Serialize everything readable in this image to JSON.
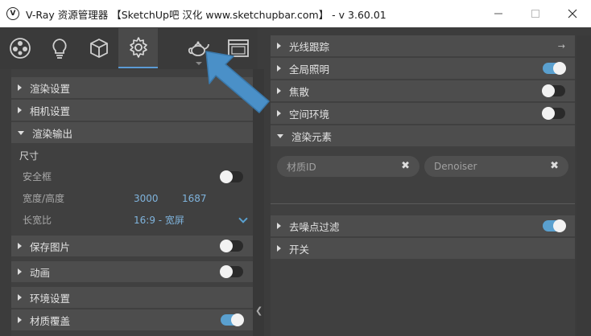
{
  "window": {
    "title": "V-Ray 资源管理器 【SketchUp吧 汉化 www.sketchupbar.com】 - v 3.60.01",
    "app_icon": "vray-logo-icon",
    "controls": [
      "minimize",
      "maximize",
      "close"
    ]
  },
  "toolbar": {
    "tools": [
      {
        "name": "materials",
        "icon": "material-palette-icon"
      },
      {
        "name": "lights",
        "icon": "bulb-icon"
      },
      {
        "name": "geometry",
        "icon": "cube-icon"
      },
      {
        "name": "settings",
        "icon": "gear-icon",
        "active": true
      },
      {
        "name": "render",
        "icon": "teapot-icon"
      },
      {
        "name": "frame-buffer",
        "icon": "frame-buffer-icon"
      }
    ]
  },
  "left": {
    "sections": {
      "render_settings": "渲染设置",
      "camera_settings": "相机设置",
      "render_output": "渲染输出"
    },
    "size_heading": "尺寸",
    "safe_frame": {
      "label": "安全框",
      "on": false
    },
    "width_height": {
      "label": "宽度/高度",
      "width": "3000",
      "height": "1687"
    },
    "aspect": {
      "label": "长宽比",
      "value": "16:9 - 宽屏"
    },
    "save_image": {
      "label": "保存图片",
      "on": false
    },
    "animation": {
      "label": "动画",
      "on": false
    },
    "environment": {
      "label": "环境设置"
    },
    "material_override": {
      "label": "材质覆盖",
      "on": true
    }
  },
  "right": {
    "raytrace": {
      "label": "光线跟踪"
    },
    "gi": {
      "label": "全局照明",
      "on": true
    },
    "caustics": {
      "label": "焦散",
      "on": false
    },
    "volumetric": {
      "label": "空间环境",
      "on": false
    },
    "render_elements": {
      "label": "渲染元素"
    },
    "chips": [
      "材质ID",
      "Denoiser"
    ],
    "denoiser": {
      "label": "去噪点过滤",
      "on": true
    },
    "switches": {
      "label": "开关"
    }
  },
  "colors": {
    "accent": "#5aa0cf",
    "callout_arrow": "#4a90c8",
    "panel": "#404040",
    "section": "#4d4d4d"
  }
}
